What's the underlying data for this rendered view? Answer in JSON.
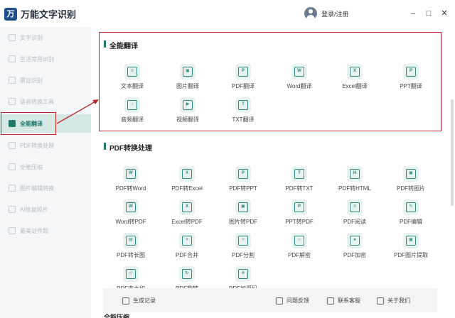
{
  "app": {
    "title": "万能文字识别",
    "login": "登录/注册"
  },
  "window": {
    "minimize": "–",
    "maximize": "□",
    "close": "✕"
  },
  "sidebar": {
    "items": [
      {
        "label": "文字识别"
      },
      {
        "label": "生活常用识别"
      },
      {
        "label": "票证识别"
      },
      {
        "label": "语音转换工具"
      },
      {
        "label": "全能翻译"
      },
      {
        "label": "PDF转换处理"
      },
      {
        "label": "全能压缩"
      },
      {
        "label": "图片编辑转换"
      },
      {
        "label": "AI修复照片"
      },
      {
        "label": "最美证件照"
      }
    ]
  },
  "translate": {
    "title": "全能翻译",
    "tools": [
      {
        "label": "文本翻译",
        "icon": "text-translate-icon",
        "glyph": "≡"
      },
      {
        "label": "图片翻译",
        "icon": "image-translate-icon",
        "glyph": "▣"
      },
      {
        "label": "PDF翻译",
        "icon": "pdf-translate-icon",
        "glyph": "P"
      },
      {
        "label": "Word翻译",
        "icon": "word-translate-icon",
        "glyph": "W"
      },
      {
        "label": "Excel翻译",
        "icon": "excel-translate-icon",
        "glyph": "X"
      },
      {
        "label": "PPT翻译",
        "icon": "ppt-translate-icon",
        "glyph": "P"
      },
      {
        "label": "音频翻译",
        "icon": "audio-translate-icon",
        "glyph": "♪"
      },
      {
        "label": "视频翻译",
        "icon": "video-translate-icon",
        "glyph": "▶"
      },
      {
        "label": "TXT翻译",
        "icon": "txt-translate-icon",
        "glyph": "T"
      }
    ]
  },
  "pdf": {
    "title": "PDF转换处理",
    "tools": [
      {
        "label": "PDF转Word",
        "icon": "pdf-to-word-icon",
        "glyph": "W"
      },
      {
        "label": "PDF转Excel",
        "icon": "pdf-to-excel-icon",
        "glyph": "X"
      },
      {
        "label": "PDF转PPT",
        "icon": "pdf-to-ppt-icon",
        "glyph": "P"
      },
      {
        "label": "PDF转TXT",
        "icon": "pdf-to-txt-icon",
        "glyph": "T"
      },
      {
        "label": "PDF转HTML",
        "icon": "pdf-to-html-icon",
        "glyph": "H"
      },
      {
        "label": "PDF转图片",
        "icon": "pdf-to-image-icon",
        "glyph": "▣"
      },
      {
        "label": "Word转PDF",
        "icon": "word-to-pdf-icon",
        "glyph": "W"
      },
      {
        "label": "Excel转PDF",
        "icon": "excel-to-pdf-icon",
        "glyph": "X"
      },
      {
        "label": "图片转PDF",
        "icon": "image-to-pdf-icon",
        "glyph": "▣"
      },
      {
        "label": "PPT转PDF",
        "icon": "ppt-to-pdf-icon",
        "glyph": "P"
      },
      {
        "label": "PDF阅读",
        "icon": "pdf-read-icon",
        "glyph": "≡"
      },
      {
        "label": "PDF编辑",
        "icon": "pdf-edit-icon",
        "glyph": "✎"
      },
      {
        "label": "PDF转长图",
        "icon": "pdf-long-image-icon",
        "glyph": "▤"
      },
      {
        "label": "PDF合并",
        "icon": "pdf-merge-icon",
        "glyph": "+"
      },
      {
        "label": "PDF分割",
        "icon": "pdf-split-icon",
        "glyph": "÷"
      },
      {
        "label": "PDF解密",
        "icon": "pdf-decrypt-icon",
        "glyph": "○"
      },
      {
        "label": "PDF加密",
        "icon": "pdf-encrypt-icon",
        "glyph": "●"
      },
      {
        "label": "PDF图片提取",
        "icon": "pdf-image-extract-icon",
        "glyph": "▣"
      },
      {
        "label": "PDF去水印",
        "icon": "pdf-remove-watermark-icon",
        "glyph": "◇"
      },
      {
        "label": "PDF旋转",
        "icon": "pdf-rotate-icon",
        "glyph": "↻"
      },
      {
        "label": "PDF加页码",
        "icon": "pdf-page-number-icon",
        "glyph": "#"
      }
    ]
  },
  "footer": {
    "history": "生成记录",
    "feedback": "问题反馈",
    "service": "联系客服",
    "about": "关于我们"
  },
  "next_section": {
    "title": "全能压缩"
  }
}
